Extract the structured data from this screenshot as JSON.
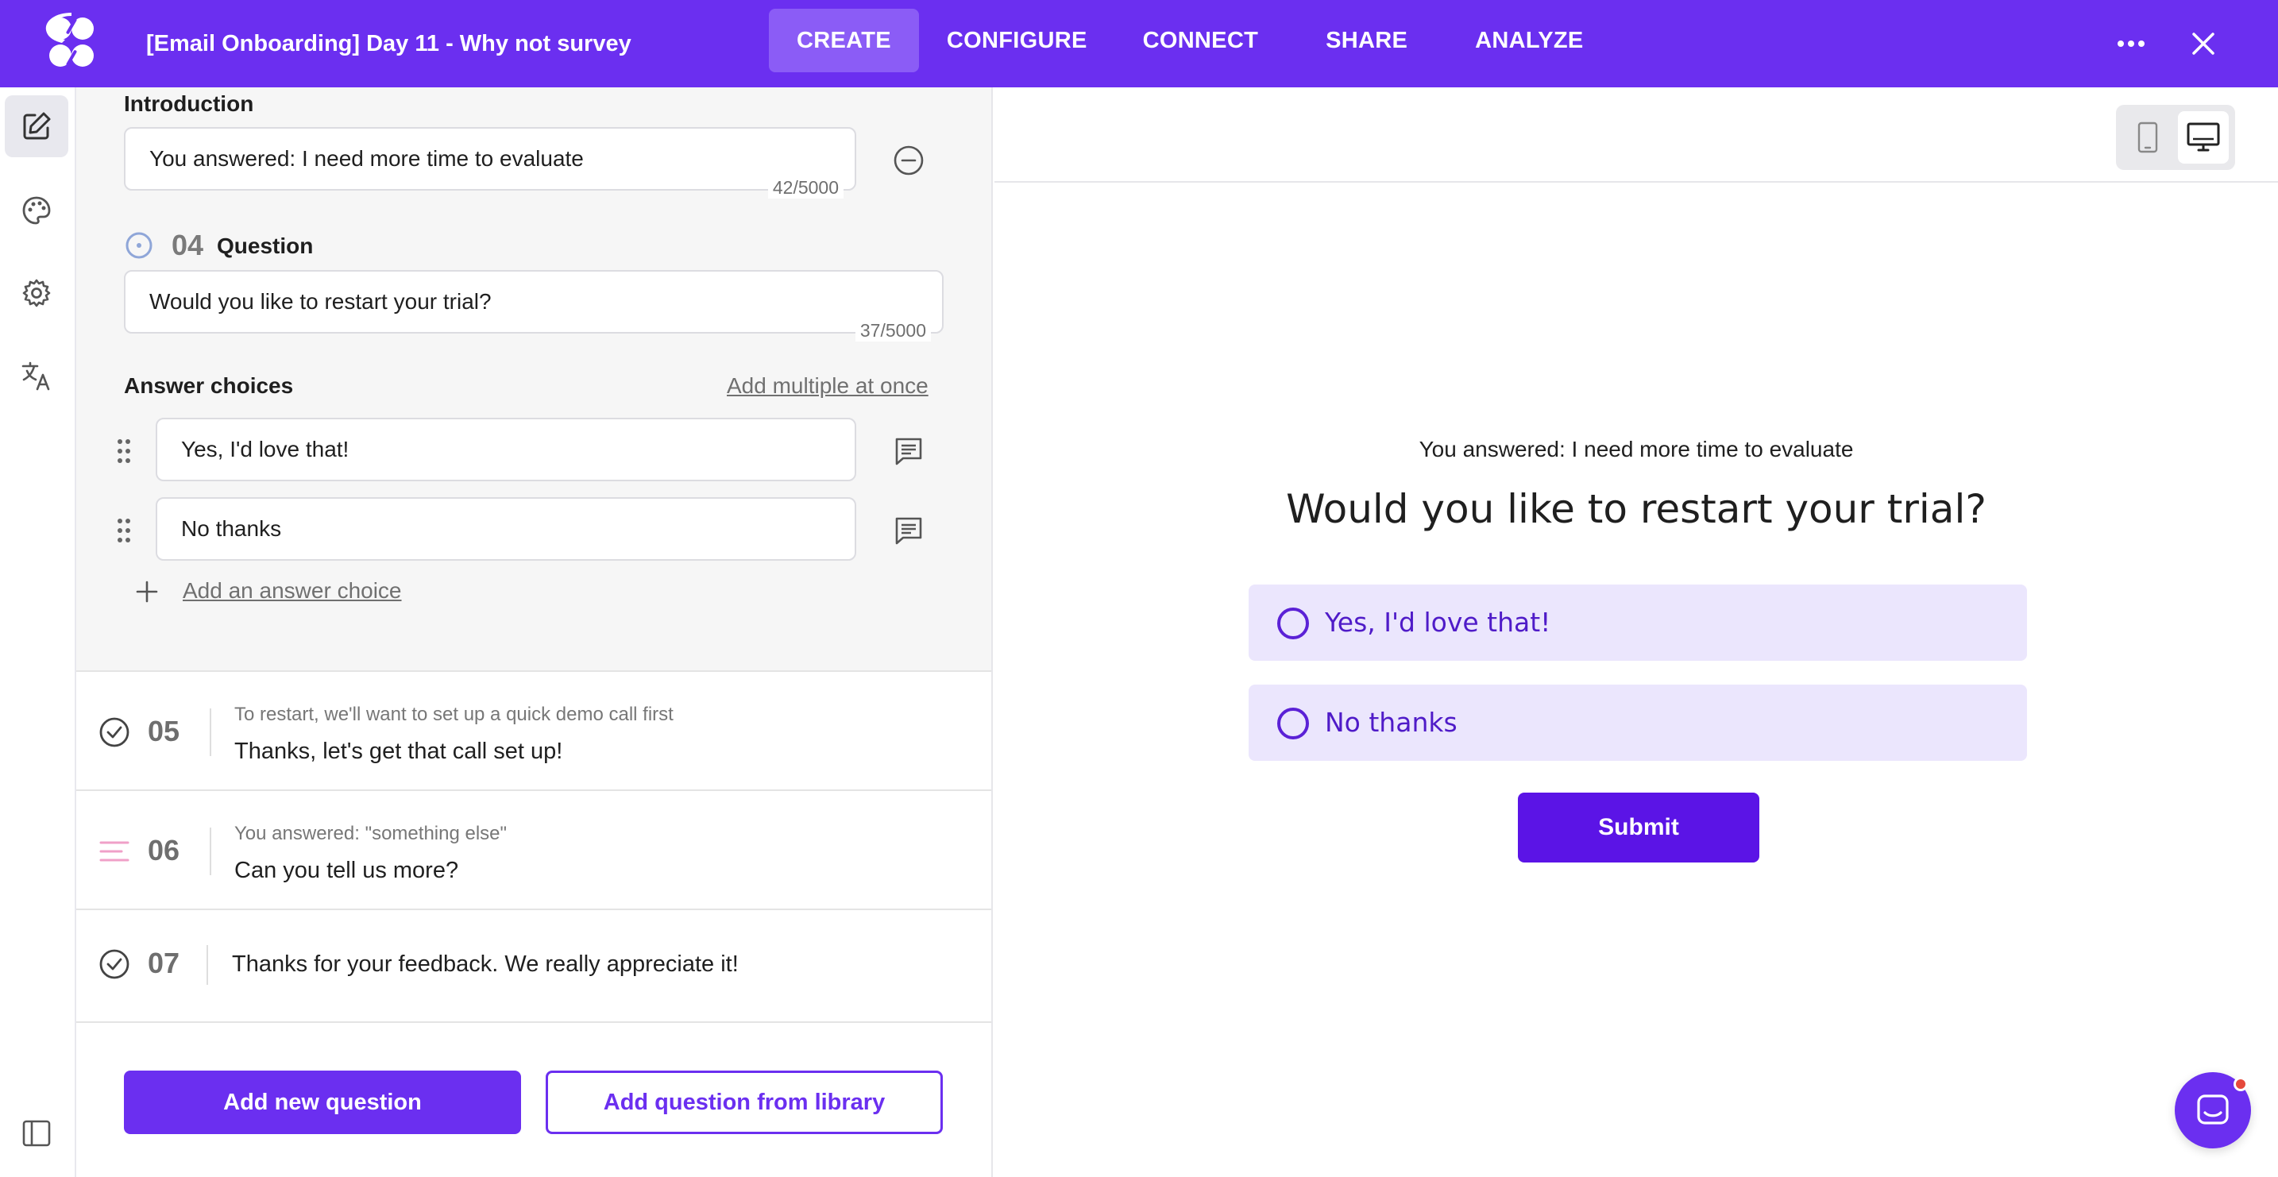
{
  "app": {
    "title": "[Email Onboarding] Day 11 -  Why not survey",
    "brand_color": "#6b2ff0"
  },
  "nav": {
    "tabs": [
      {
        "label": "CREATE",
        "active": true
      },
      {
        "label": "CONFIGURE",
        "active": false
      },
      {
        "label": "CONNECT",
        "active": false
      },
      {
        "label": "SHARE",
        "active": false
      },
      {
        "label": "ANALYZE",
        "active": false
      }
    ],
    "more_icon": "more-horizontal-icon",
    "close_icon": "close-icon"
  },
  "rail": {
    "items": [
      {
        "icon": "edit-icon",
        "active": true
      },
      {
        "icon": "palette-icon",
        "active": false
      },
      {
        "icon": "gear-icon",
        "active": false
      },
      {
        "icon": "translate-icon",
        "active": false
      }
    ],
    "bottom_icon": "sidebar-toggle-icon"
  },
  "editor": {
    "intro_label": "Introduction",
    "intro_value": "You answered: I need more time to evaluate",
    "intro_counter": "42/5000",
    "question_number": "04",
    "question_label": "Question",
    "question_value": "Would you like to restart your trial?",
    "question_counter": "37/5000",
    "answer_choices_label": "Answer choices",
    "add_multiple_link": "Add multiple at once",
    "choices": [
      {
        "value": "Yes, I'd love that!"
      },
      {
        "value": "No thanks"
      }
    ],
    "add_choice_link": "Add an answer choice",
    "collapsed_questions": [
      {
        "number": "05",
        "subtitle": "To restart, we'll want to set up a quick demo call first",
        "title": "Thanks, let's get that call set up!",
        "icon": "check-circle-icon"
      },
      {
        "number": "06",
        "subtitle": "You answered: \"something else\"",
        "title": "Can you tell us more?",
        "icon": "text-lines-icon"
      },
      {
        "number": "07",
        "subtitle": "",
        "title": "Thanks for your feedback. We really appreciate it!",
        "icon": "check-circle-icon"
      }
    ],
    "add_question_button": "Add new question",
    "add_from_library_button": "Add question from library"
  },
  "preview": {
    "device": "desktop",
    "intro": "You answered: I need more time to evaluate",
    "question": "Would you like to restart your trial?",
    "choices": [
      "Yes, I'd love that!",
      "No thanks"
    ],
    "submit_label": "Submit",
    "choice_bg": "#ebe6fd",
    "accent": "#5b14e6"
  }
}
